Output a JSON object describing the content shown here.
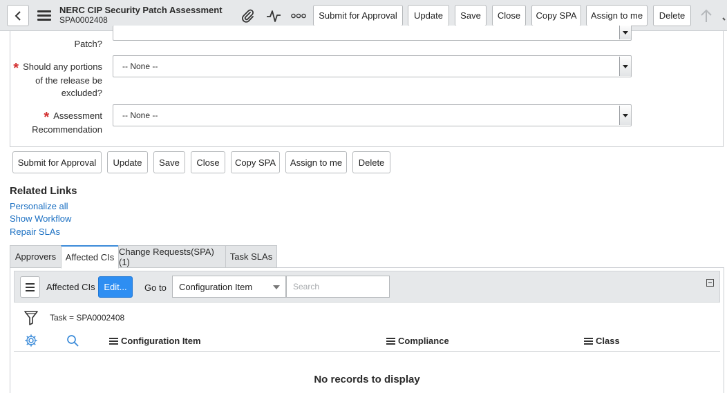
{
  "header": {
    "title": "NERC CIP Security Patch Assessment",
    "record_number": "SPA0002408",
    "buttons": {
      "submit": "Submit for Approval",
      "update": "Update",
      "save": "Save",
      "close": "Close",
      "copy": "Copy SPA",
      "assign": "Assign to me",
      "delete": "Delete"
    },
    "icons": [
      "back-icon",
      "hamburger-menu-icon",
      "paperclip-icon",
      "activity-icon",
      "more-options-icon",
      "up-arrow-icon"
    ]
  },
  "form": {
    "partial_label": "Patch?",
    "fields": [
      {
        "label": "Should any portions of the release be excluded?",
        "required": true,
        "value": "-- None --"
      },
      {
        "label": "Assessment Recommendation",
        "required": true,
        "value": "-- None --"
      }
    ],
    "required_marker": "*",
    "buttons": {
      "submit": "Submit for Approval",
      "update": "Update",
      "save": "Save",
      "close": "Close",
      "copy": "Copy SPA",
      "assign": "Assign to me",
      "delete": "Delete"
    }
  },
  "related_links": {
    "title": "Related Links",
    "links": [
      "Personalize all",
      "Show Workflow",
      "Repair SLAs"
    ]
  },
  "tabs": [
    "Approvers",
    "Affected CIs",
    "Change Requests(SPA) (1)",
    "Task SLAs"
  ],
  "active_tab": "Affected CIs",
  "list": {
    "title": "Affected CIs",
    "edit_label": "Edit...",
    "goto_label": "Go to",
    "goto_value": "Configuration Item",
    "search_placeholder": "Search",
    "filter_text": "Task = SPA0002408",
    "columns": [
      "Configuration Item",
      "Compliance",
      "Class"
    ],
    "empty_message": "No records to display"
  },
  "colors": {
    "accent": "#2e8ef2",
    "link": "#1a6fc2",
    "required": "#d32f2f",
    "header_bg": "#e6e8ea"
  }
}
